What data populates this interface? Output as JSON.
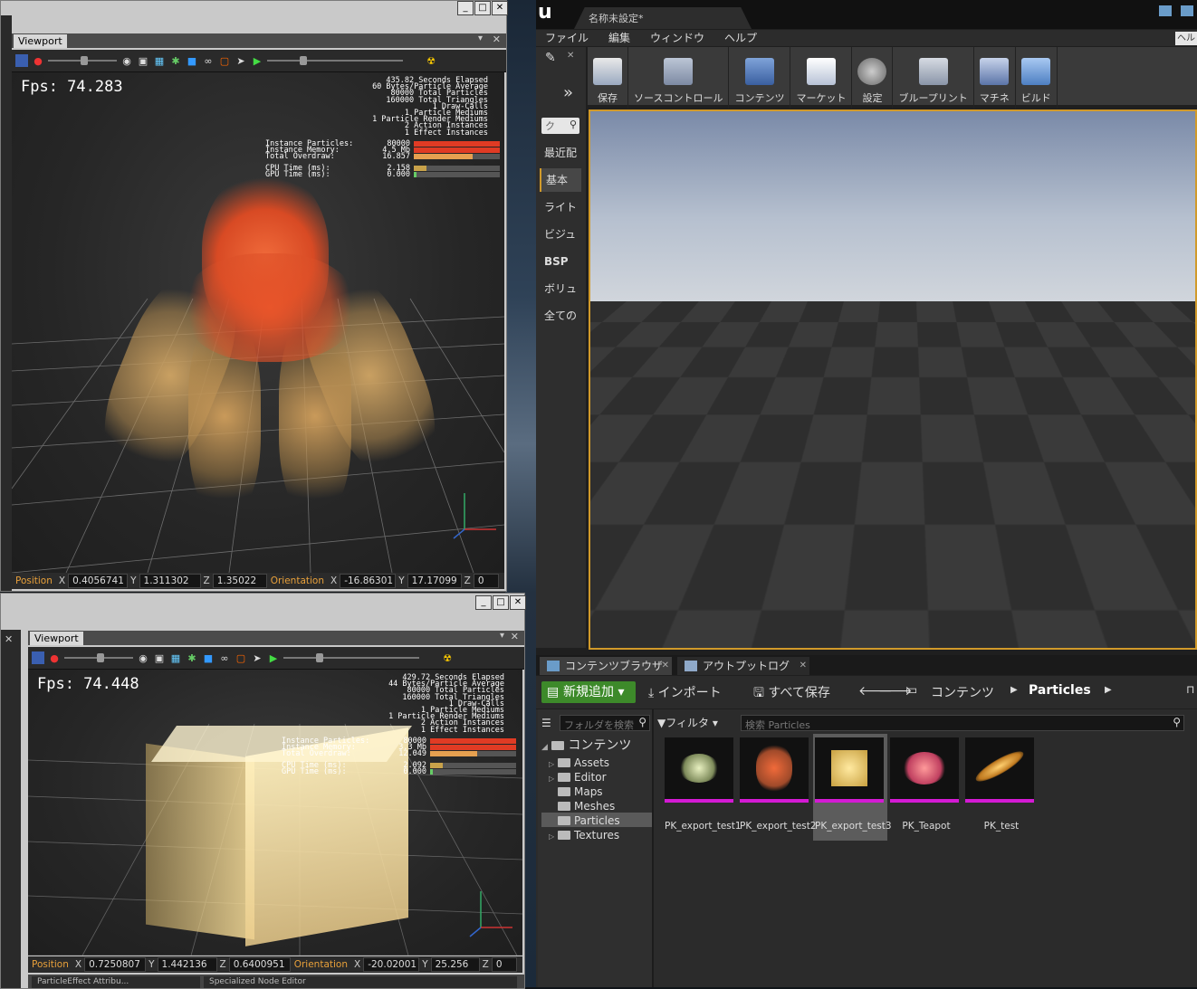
{
  "pk_top": {
    "tab": "Viewport",
    "fps": "Fps: 74.283",
    "stats_block": "435.82 Seconds Elapsed\n60 Bytes/Particle Average\n80000 Total Particles\n160000 Total Triangles\n1 Draw-Calls\n1 Particle Mediums\n1 Particle Render Mediums\n2 Action Instances\n1 Effect Instances",
    "inst_labels": "Instance Particles:\nInstance Memory:\nTotal Overdraw:",
    "inst_values": "80000\n4.5 Mb\n16.857",
    "time_labels": "CPU Time (ms):\nGPU Time (ms):",
    "time_values": "2.158\n0.000",
    "position_label": "Position",
    "x_label": "X",
    "y_label": "Y",
    "z_label": "Z",
    "pos_x": "0.4056741",
    "pos_y": "1.311302",
    "pos_z": "1.35022",
    "orientation_label": "Orientation",
    "ori_x": "-16.86301",
    "ori_y": "17.17099",
    "ori_z": "0",
    "overdraw_fill": 0.68
  },
  "pk_bottom": {
    "tab": "Viewport",
    "fps": "Fps: 74.448",
    "stats_block": "429.72 Seconds Elapsed\n44 Bytes/Particle Average\n80000 Total Particles\n160000 Total Triangles\n1 Draw-Calls\n1 Particle Mediums\n1 Particle Render Mediums\n2 Action Instances\n1 Effect Instances",
    "inst_labels": "Instance Particles:\nInstance Memory:\nTotal Overdraw:",
    "inst_values": "80000\n3.3 Mb\n12.049",
    "time_labels": "CPU Time (ms):\nGPU Time (ms):",
    "time_values": "2.092\n0.000",
    "position_label": "Position",
    "x_label": "X",
    "y_label": "Y",
    "z_label": "Z",
    "pos_x": "0.7250807",
    "pos_y": "1.442136",
    "pos_z": "0.6400951",
    "orientation_label": "Orientation",
    "ori_x": "-20.02001",
    "ori_y": "25.256",
    "ori_z": "0",
    "bottom_tab1": "ParticleEffect Attribu...",
    "bottom_tab2": "Specialized Node Editor",
    "overdraw_fill": 0.55
  },
  "window_buttons": {
    "minimize": "_",
    "maximize": "□",
    "close": "✕"
  },
  "ue": {
    "doc_tab": "名称未設定*",
    "menu": [
      "ファイル",
      "編集",
      "ウィンドウ",
      "ヘルプ"
    ],
    "help_corner": "ヘル",
    "toolbar": [
      "保存",
      "ソースコントロール",
      "コンテンツ",
      "マーケット",
      "設定",
      "ブループリント",
      "マチネ",
      "ビルド"
    ],
    "modes_search": "ク",
    "modes": [
      "最近配",
      "基本",
      "ライト",
      "ビジュ",
      "BSP",
      "ボリュ",
      "全ての"
    ],
    "active_mode": "基本",
    "content_browser": {
      "tabs": [
        "コンテンツブラウザ",
        "アウトプットログ"
      ],
      "add_new": "新規追加",
      "import": "インポート",
      "save_all": "すべて保存",
      "path_root": "コンテンツ",
      "path_current": "Particles",
      "folder_search_placeholder": "フォルダを検索",
      "filter": "フィルタ",
      "asset_search_placeholder": "検索 Particles",
      "tree_root": "コンテンツ",
      "tree": [
        "Assets",
        "Editor",
        "Maps",
        "Meshes",
        "Particles",
        "Textures"
      ],
      "selected_folder": "Particles",
      "assets": [
        "PK_export_test1",
        "PK_export_test2",
        "PK_export_test3",
        "PK_Teapot",
        "PK_test"
      ],
      "selected_asset": "PK_export_test3"
    }
  },
  "colors": {
    "accent_orange": "#e8a03a",
    "viewport_border": "#d19a2a",
    "asset_underline": "#d41ad4",
    "add_new_green": "#3d8a2a",
    "bar_red": "#e03b24"
  }
}
